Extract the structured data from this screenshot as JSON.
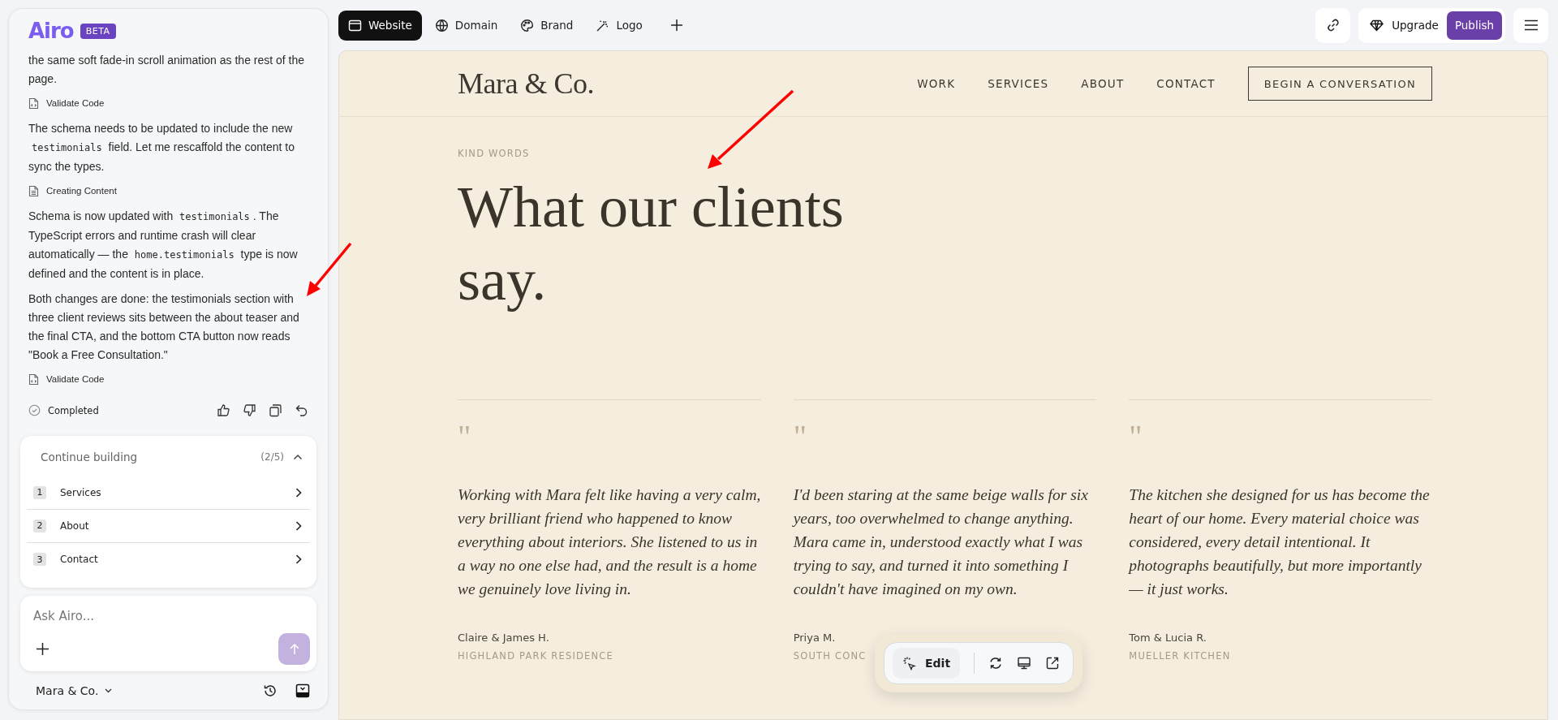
{
  "sidebar": {
    "logo": "Airo",
    "badge": "BETA",
    "messages": [
      {
        "kind": "text",
        "parts": [
          {
            "text": "the same soft fade-in scroll animation as the rest of the page.",
            "code": false
          }
        ]
      },
      {
        "kind": "code-step",
        "label": "Validate Code"
      },
      {
        "kind": "text",
        "parts": [
          {
            "text": "The schema needs to be updated to include the new ",
            "code": false
          },
          {
            "text": "testimonials",
            "code": true
          },
          {
            "text": " field. Let me rescaffold the content to sync the types.",
            "code": false
          }
        ]
      },
      {
        "kind": "document-step",
        "label": "Creating Content"
      },
      {
        "kind": "text",
        "parts": [
          {
            "text": "Schema is now updated with ",
            "code": false
          },
          {
            "text": "testimonials",
            "code": true
          },
          {
            "text": ". The TypeScript errors and runtime crash will clear automatically — the ",
            "code": false
          },
          {
            "text": "home.testimonials",
            "code": true
          },
          {
            "text": " type is now defined and the content is in place.",
            "code": false
          }
        ]
      },
      {
        "kind": "text",
        "parts": [
          {
            "text": "Both changes are done: the testimonials section with three client reviews sits between the about teaser and the final CTA, and the bottom CTA button now reads \"Book a Free Consultation.\"",
            "code": false
          }
        ]
      },
      {
        "kind": "code-step",
        "label": "Validate Code"
      }
    ],
    "status": "Completed",
    "continue": {
      "title": "Continue building",
      "count": "(2/5)",
      "expanded": true,
      "items": [
        {
          "number": "1",
          "label": "Services"
        },
        {
          "number": "2",
          "label": "About"
        },
        {
          "number": "3",
          "label": "Contact"
        }
      ]
    },
    "composer": {
      "placeholder": "Ask Airo..."
    },
    "project": "Mara & Co."
  },
  "toolbar": {
    "tabs": [
      {
        "label": "Website",
        "selected": true
      },
      {
        "label": "Domain",
        "selected": false
      },
      {
        "label": "Brand",
        "selected": false
      },
      {
        "label": "Logo",
        "selected": false
      }
    ],
    "upgrade": "Upgrade",
    "publish": "Publish"
  },
  "site": {
    "logo": "Mara & Co.",
    "nav": [
      "WORK",
      "SERVICES",
      "ABOUT",
      "CONTACT"
    ],
    "cta": "BEGIN A CONVERSATION",
    "eyebrow": "KIND WORDS",
    "heading": "What our clients say.",
    "testimonials": [
      {
        "mark": "\"",
        "quote": "Working with Mara felt like having a very calm, very brilliant friend who happened to know everything about interiors. She listened to us in a way no one else had, and the result is a home we genuinely love living in.",
        "author": "Claire & James H.",
        "place": "HIGHLAND PARK RESIDENCE"
      },
      {
        "mark": "\"",
        "quote": "I'd been staring at the same beige walls for six years, too overwhelmed to change anything. Mara came in, understood exactly what I was trying to say, and turned it into something I couldn't have imagined on my own.",
        "author": "Priya M.",
        "place": "SOUTH CONC"
      },
      {
        "mark": "\"",
        "quote": "The kitchen she designed for us has become the heart of our home. Every material choice was considered, every detail intentional. It photographs beautifully, but more importantly — it just works.",
        "author": "Tom & Lucia R.",
        "place": "MUELLER KITCHEN"
      }
    ],
    "edit": "Edit"
  }
}
